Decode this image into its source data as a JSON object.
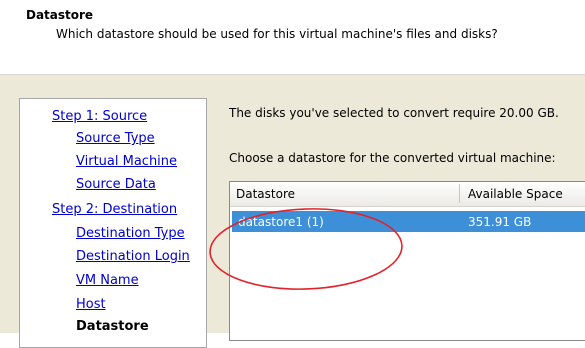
{
  "header": {
    "title": "Datastore",
    "subtitle": "Which datastore should be used for this virtual machine's files and disks?"
  },
  "nav": {
    "step1": "Step 1: Source",
    "source_type": "Source Type",
    "virtual_machine": "Virtual Machine",
    "source_data": "Source Data",
    "step2": "Step 2: Destination",
    "destination_type": "Destination Type",
    "destination_login": "Destination Login",
    "vm_name": "VM Name",
    "host": "Host",
    "datastore": "Datastore"
  },
  "main": {
    "info": "The disks you've selected to convert require 20.00 GB.",
    "choose": "Choose a datastore for the converted virtual machine:",
    "columns": [
      "Datastore",
      "Available Space"
    ],
    "rows": [
      {
        "name": "datastore1 (1)",
        "space": "351.91 GB",
        "selected": true
      }
    ]
  },
  "colors": {
    "selection": "#3d8fd8",
    "annotation": "#e0242b",
    "link": "#0000cc"
  }
}
